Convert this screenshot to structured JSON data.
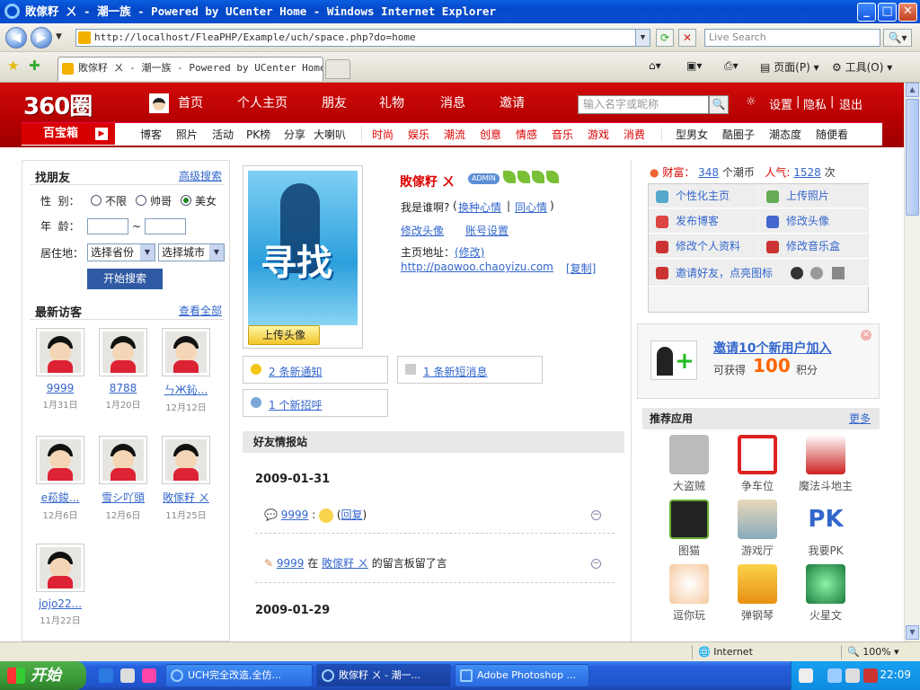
{
  "browser": {
    "title": "敗傢籽 ㄨ - 潮一族 - Powered by UCenter Home - Windows Internet Explorer",
    "address": "http://localhost/FleaPHP/Example/uch/space.php?do=home",
    "search_placeholder": "Live Search",
    "tab_title": "敗傢籽 ㄨ - 潮一族 - Powered by UCenter Home",
    "toolbar": {
      "page": "页面(P)",
      "tools": "工具(O)"
    },
    "status": {
      "zone": "Internet",
      "zoom": "100%"
    }
  },
  "site": {
    "logo": "360圈",
    "nav": [
      "首页",
      "个人主页",
      "朋友",
      "礼物",
      "消息",
      "邀请"
    ],
    "search_placeholder": "输入名字或昵称",
    "links": {
      "settings": "设置",
      "privacy": "隐私",
      "logout": "退出"
    },
    "baibao": "百宝箱",
    "subnav_a": [
      "博客",
      "照片",
      "活动",
      "PK榜",
      "分享",
      "大喇叭"
    ],
    "subnav_b": [
      "时尚",
      "娱乐",
      "潮流",
      "创意",
      "情感",
      "音乐",
      "游戏",
      "消费"
    ],
    "subnav_c": [
      "型男女",
      "酷圈子",
      "潮态度",
      "随便看"
    ]
  },
  "left": {
    "find_title": "找朋友",
    "advanced": "高级搜索",
    "gender_label": "性  别：",
    "gender_opts": [
      "不限",
      "帅哥",
      "美女"
    ],
    "age_label": "年  龄：",
    "age_sep": "~",
    "loc_label": "居住地：",
    "province": "选择省份",
    "city": "选择城市",
    "search_btn": "开始搜索",
    "visitors_title": "最新访客",
    "view_all": "查看全部",
    "visitors": [
      {
        "name": "9999",
        "date": "1月31日"
      },
      {
        "name": "8788",
        "date": "1月20日"
      },
      {
        "name": "ㄣЖ鈊...",
        "date": "12月12日"
      },
      {
        "name": "e菘鋑...",
        "date": "12月6日"
      },
      {
        "name": "雪シ吖頭",
        "date": "12月6日"
      },
      {
        "name": "敗傢籽 ㄨ",
        "date": "11月25日"
      },
      {
        "name": "jojo22...",
        "date": "11月22日"
      }
    ]
  },
  "profile": {
    "avatar_word": "寻找",
    "upload": "上传头像",
    "name": "敗傢籽 ㄨ",
    "badge": "ADMIN",
    "mood_q": "我是谁啊?",
    "mood_links": [
      "换种心情",
      "同心情"
    ],
    "edit_avatar": "修改头像",
    "account": "账号设置",
    "home_label": "主页地址：",
    "home_edit": "(修改)",
    "home_url": "http://paowoo.chaoyizu.com",
    "copy": "[复制]",
    "notice1": "2 条新通知",
    "notice2": "1 条新短消息",
    "notice3": "1 个新招呼"
  },
  "feed": {
    "title": "好友情报站",
    "date1": "2009-01-31",
    "item1_user": "9999",
    "item1_reply": "回复",
    "item2_user": "9999",
    "item2_mid": "在",
    "item2_target": "敗傢籽 ㄨ",
    "item2_tail": "的留言板留了言",
    "date2": "2009-01-29"
  },
  "right": {
    "wealth_label": "财富：",
    "wealth": "348",
    "wealth_unit": "个潮币",
    "pop_label": "人气:",
    "pop": "1528",
    "pop_unit": "次",
    "quick": [
      "个性化主页",
      "上传照片",
      "发布博客",
      "修改头像",
      "修改个人资料",
      "修改音乐盒"
    ],
    "invite_friends": "邀请好友，点亮图标",
    "invite_title": "邀请10个新用户加入",
    "invite_sub": "可获得",
    "invite_pts": "100",
    "invite_unit": "积分",
    "apps_title": "推荐应用",
    "apps_more": "更多",
    "apps": [
      "大盗贼",
      "争车位",
      "魔法斗地主",
      "图猫",
      "游戏厅",
      "我要PK",
      "逗你玩",
      "弹钢琴",
      "火星文"
    ]
  },
  "taskbar": {
    "start": "开始",
    "tasks": [
      "UCH完全改造,全仿...",
      "敗傢籽 ㄨ - 潮一...",
      "Adobe Photoshop ..."
    ],
    "clock": "22:09"
  }
}
